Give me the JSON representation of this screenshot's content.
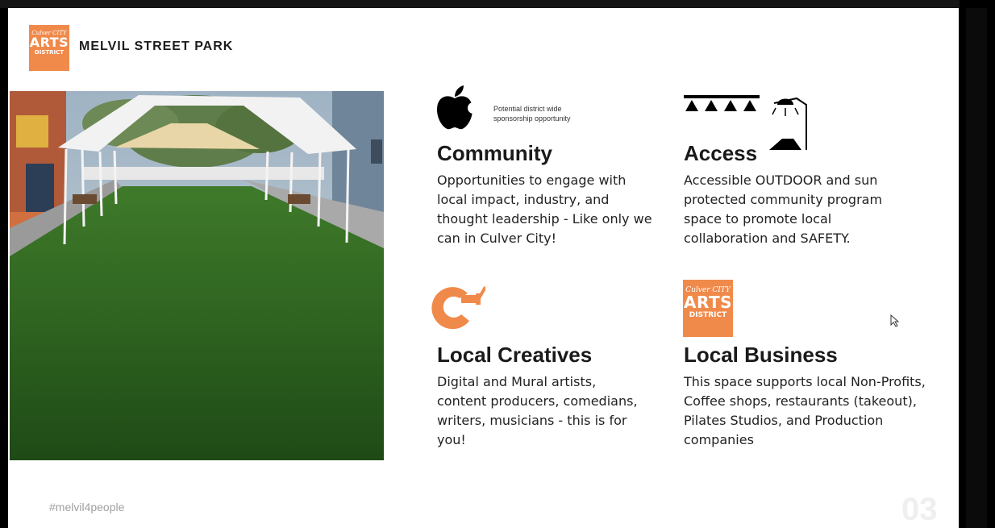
{
  "slide": {
    "title": "MELVIL STREET PARK",
    "hashtag": "#melvil4people",
    "page_number": "03"
  },
  "logo": {
    "line1": "Culver CITY",
    "line2": "ARTS",
    "line3": "DISTRICT",
    "icon": "arts-district-logo"
  },
  "photo": {
    "icon": "park-tent-photo"
  },
  "sections": {
    "community": {
      "heading": "Community",
      "body": "Opportunities to engage with local impact, industry, and thought leadership - Like only we can in Culver City!",
      "icon": "apple-icon",
      "note": "Potential district wide sponsorship opportunity"
    },
    "access": {
      "heading": "Access",
      "body": "Accessible OUTDOOR and sun protected community program space to promote local collaboration and SAFETY.",
      "icon": "lighting-icon"
    },
    "creatives": {
      "heading": "Local Creatives",
      "body": "Digital and Mural artists, content producers, comedians, writers, musicians - this is for you!",
      "icon": "paint-brush-c-icon"
    },
    "business": {
      "heading": "Local Business",
      "body": "This space supports local Non-Profits, Coffee shops, restaurants (takeout), Pilates Studios, and Production companies",
      "icon": "arts-district-logo"
    }
  },
  "colors": {
    "accent": "#f08a4b",
    "text": "#1a1a1a",
    "hashtag": "#a0a0a0"
  }
}
